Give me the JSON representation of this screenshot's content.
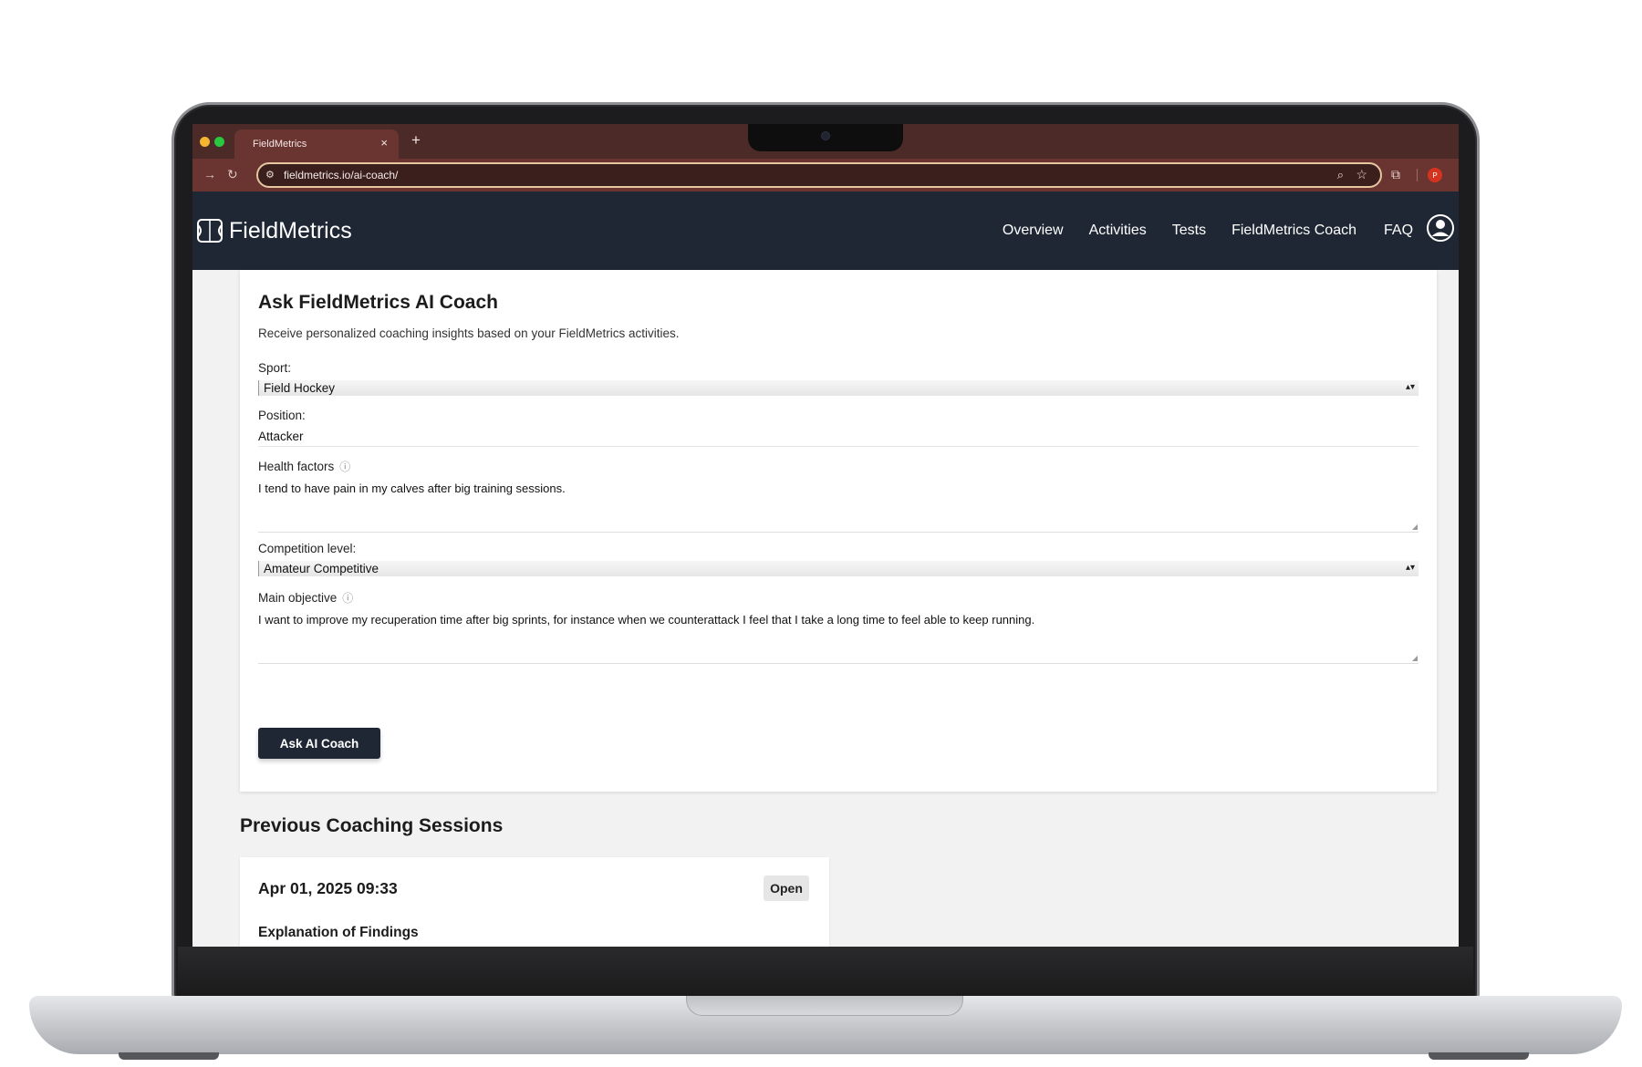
{
  "browser": {
    "tab_title": "FieldMetrics",
    "tab_close": "×",
    "new_tab": "+",
    "url": "fieldmetrics.io/ai-coach/",
    "profile_initial": "P"
  },
  "app": {
    "brand": "FieldMetrics",
    "nav": {
      "overview": "Overview",
      "activities": "Activities",
      "tests": "Tests",
      "coach": "FieldMetrics Coach",
      "faq": "FAQ"
    }
  },
  "form": {
    "title": "Ask FieldMetrics AI Coach",
    "subtitle": "Receive personalized coaching insights based on your FieldMetrics activities.",
    "sport_label": "Sport:",
    "sport_value": "Field Hockey",
    "position_label": "Position:",
    "position_value": "Attacker",
    "health_label": "Health factors",
    "health_value": "I tend to have pain in my calves after big training sessions.",
    "competition_label": "Competition level:",
    "competition_value": "Amateur Competitive",
    "objective_label": "Main objective",
    "objective_value": "I want to improve my recuperation time after big sprints, for instance when we counterattack I feel that I take a long time to feel able to keep running.",
    "submit_label": "Ask AI Coach"
  },
  "sessions": {
    "title": "Previous Coaching Sessions",
    "items": [
      {
        "date": "Apr 01, 2025 09:33",
        "open_label": "Open",
        "heading": "Explanation of Findings"
      }
    ]
  },
  "icons": {
    "info": "info-icon",
    "user": "user-icon",
    "logo": "field-logo-icon"
  }
}
